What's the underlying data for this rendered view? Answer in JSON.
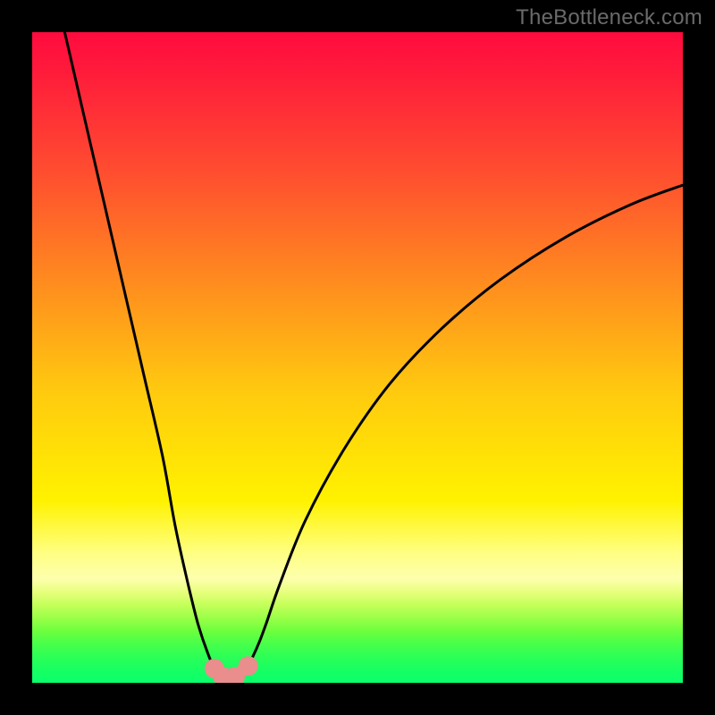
{
  "watermark": "TheBottleneck.com",
  "chart_data": {
    "type": "line",
    "title": "",
    "xlabel": "",
    "ylabel": "",
    "xlim": [
      0,
      100
    ],
    "ylim": [
      0,
      100
    ],
    "grid": false,
    "legend": false,
    "series": [
      {
        "name": "bottleneck-curve",
        "color": "#000000",
        "x": [
          5,
          8,
          11,
          14,
          17,
          20,
          22,
          24,
          25.5,
          27,
          28,
          29,
          29.8,
          30.5,
          31.5,
          33,
          34,
          35,
          36,
          38,
          42,
          48,
          55,
          63,
          72,
          82,
          92,
          100
        ],
        "y": [
          100,
          87,
          74,
          61,
          48,
          35,
          24,
          15,
          9,
          4.5,
          2.3,
          1.2,
          0.8,
          0.8,
          1.1,
          2.4,
          4.2,
          6.5,
          9.2,
          15,
          25,
          36,
          46,
          54.5,
          62,
          68.5,
          73.5,
          76.5
        ]
      }
    ],
    "markers": [
      {
        "name": "vertex-left",
        "x": 28.0,
        "y": 2.2,
        "r": 1.5,
        "color": "#e98d8d"
      },
      {
        "name": "vertex-mid-l",
        "x": 29.3,
        "y": 0.95,
        "r": 1.5,
        "color": "#e98d8d"
      },
      {
        "name": "vertex-mid-r",
        "x": 31.2,
        "y": 0.95,
        "r": 1.5,
        "color": "#e98d8d"
      },
      {
        "name": "vertex-right",
        "x": 33.2,
        "y": 2.6,
        "r": 1.5,
        "color": "#e98d8d"
      }
    ],
    "marker_segments": [
      {
        "from": 0,
        "to": 1
      },
      {
        "from": 1,
        "to": 2
      },
      {
        "from": 2,
        "to": 3
      }
    ],
    "gradient_stops": [
      {
        "pos": 0,
        "color": "#ff0b3e"
      },
      {
        "pos": 72,
        "color": "#fff200"
      },
      {
        "pos": 100,
        "color": "#0aff6c"
      }
    ]
  }
}
